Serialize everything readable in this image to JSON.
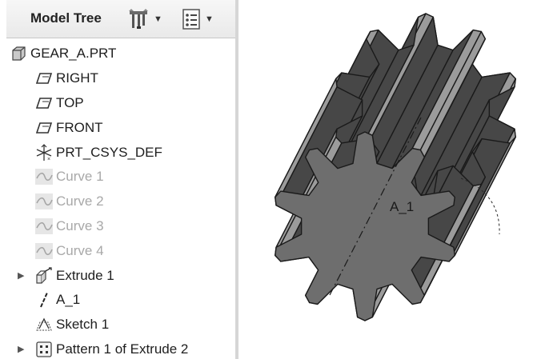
{
  "model_tree": {
    "title": "Model Tree",
    "settings_icon": "tools-icon",
    "show_icon": "list-icon",
    "items": [
      {
        "label": "GEAR_A.PRT",
        "icon": "part-icon",
        "level": 0,
        "dimmed": false,
        "expandable": false
      },
      {
        "label": "RIGHT",
        "icon": "datum-plane-icon",
        "level": 1,
        "dimmed": false,
        "expandable": false
      },
      {
        "label": "TOP",
        "icon": "datum-plane-icon",
        "level": 1,
        "dimmed": false,
        "expandable": false
      },
      {
        "label": "FRONT",
        "icon": "datum-plane-icon",
        "level": 1,
        "dimmed": false,
        "expandable": false
      },
      {
        "label": "PRT_CSYS_DEF",
        "icon": "coordinate-system-icon",
        "level": 1,
        "dimmed": false,
        "expandable": false
      },
      {
        "label": "Curve 1",
        "icon": "curve-icon",
        "level": 1,
        "dimmed": true,
        "expandable": false
      },
      {
        "label": "Curve 2",
        "icon": "curve-icon",
        "level": 1,
        "dimmed": true,
        "expandable": false
      },
      {
        "label": "Curve 3",
        "icon": "curve-icon",
        "level": 1,
        "dimmed": true,
        "expandable": false
      },
      {
        "label": "Curve 4",
        "icon": "curve-icon",
        "level": 1,
        "dimmed": true,
        "expandable": false
      },
      {
        "label": "Extrude 1",
        "icon": "extrude-icon",
        "level": 1,
        "dimmed": false,
        "expandable": true
      },
      {
        "label": "A_1",
        "icon": "datum-axis-icon",
        "level": 1,
        "dimmed": false,
        "expandable": false
      },
      {
        "label": "Sketch 1",
        "icon": "sketch-icon",
        "level": 1,
        "dimmed": false,
        "expandable": false
      },
      {
        "label": "Pattern 1 of Extrude 2",
        "icon": "pattern-icon",
        "level": 1,
        "dimmed": false,
        "expandable": true
      }
    ]
  },
  "viewport": {
    "model": "spur gear",
    "axis_label": "A_1",
    "colors": {
      "face_front": "#6e6e6e",
      "tooth_side_dark": "#474747",
      "tooth_top_light": "#9b9b9b",
      "edge": "#1a1a1a"
    }
  }
}
